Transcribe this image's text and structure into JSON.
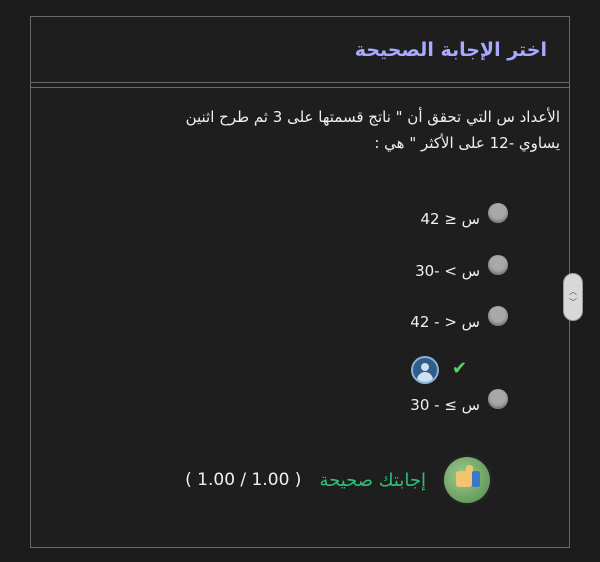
{
  "header": {
    "title": "اختر الإجابة الصحيحة"
  },
  "question": {
    "line1": "الأعداد س التي تحقق أن  \" ناتج قسمتها على 3 ثم طرح اثنين",
    "line2": "يساوي  -12  على الأكثر \" هي :"
  },
  "options": [
    {
      "label": "س ≤  42"
    },
    {
      "label": "س > -30"
    },
    {
      "label": "س < - 42"
    },
    {
      "label": "س ≥ - 30"
    }
  ],
  "feedback": {
    "text": "إجابتك صحيحة",
    "score": "( 1.00 / 1.00 )"
  },
  "icons": {
    "check": "check-icon",
    "user": "user-icon",
    "thumbs_up": "thumbs-up-icon"
  },
  "colors": {
    "title": "#a9a9ff",
    "correct": "#2fbf7a",
    "check": "#5fd35f"
  }
}
